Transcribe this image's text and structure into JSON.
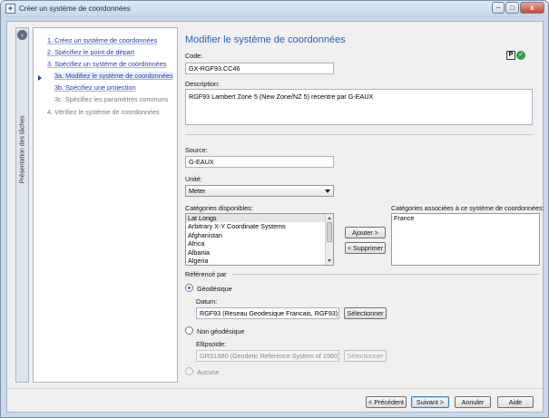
{
  "window": {
    "title": "Créer un système de coordonnées",
    "app_icon": "map-icon",
    "controls": {
      "minimize": "−",
      "maximize": "□",
      "close": "x"
    }
  },
  "tasks_panel": {
    "title": "Présentation des tâches",
    "collapse_glyph": "‹",
    "steps": [
      {
        "label": "1. Créez un système de coordonnées",
        "state": "done"
      },
      {
        "label": "2. Spécifiez le point de départ",
        "state": "done"
      },
      {
        "label": "3. Spécifiez un système de coordonnées",
        "state": "done"
      },
      {
        "label": "3a. Modifiez le système de coordonnées",
        "state": "current"
      },
      {
        "label": "3b. Spécifiez une projection",
        "state": "done"
      },
      {
        "label": "3c. Spécifiez les paramètres communs",
        "state": "disabled"
      },
      {
        "label": "4. Vérifiez le système de coordonnées",
        "state": "disabled"
      }
    ]
  },
  "main": {
    "heading": "Modifier le système de coordonnées",
    "status_icons": {
      "p_badge": "P",
      "ok_badge": "✓"
    },
    "code": {
      "label": "Code:",
      "value": "GX-RGF93.CC46"
    },
    "description": {
      "label": "Description:",
      "value": "RGF93 Lambert Zone 5 (New Zone/NZ 5) recentre par G-EAUX"
    },
    "source": {
      "label": "Source:",
      "value": "G-EAUX"
    },
    "unit": {
      "label": "Unité:",
      "value": "Meter"
    },
    "available_categories": {
      "label": "Catégories disponibles:",
      "items": [
        "Lat Longs",
        "Arbitrary X-Y Coordinate Systems",
        "Afghanistan",
        "Africa",
        "Albania",
        "Algeria"
      ]
    },
    "add_button": "Ajouter >",
    "remove_button": "< Supprimer",
    "associated_categories": {
      "label": "Catégories associées à ce système de coordonnées:",
      "items": [
        "France"
      ]
    },
    "referenced_by": {
      "label": "Référencé par",
      "geodesic": {
        "label": "Géodésique",
        "checked": true
      },
      "datum": {
        "label": "Datum:",
        "value": "RGF93 (Reseau Geodesique Francais, RGF93)",
        "button": "Sélectionner"
      },
      "non_geodesic": {
        "label": "Non géodésique",
        "checked": false
      },
      "ellipsoid": {
        "label": "Ellipsoïde:",
        "value": "GRS1980 (Geodetic Reference System of 1980)",
        "button": "Sélectionner"
      },
      "none": {
        "label": "Aucune",
        "checked": false
      }
    }
  },
  "footer": {
    "previous": "< Précédent",
    "next": "Suivant >",
    "cancel": "Annuler",
    "help": "Aide"
  }
}
